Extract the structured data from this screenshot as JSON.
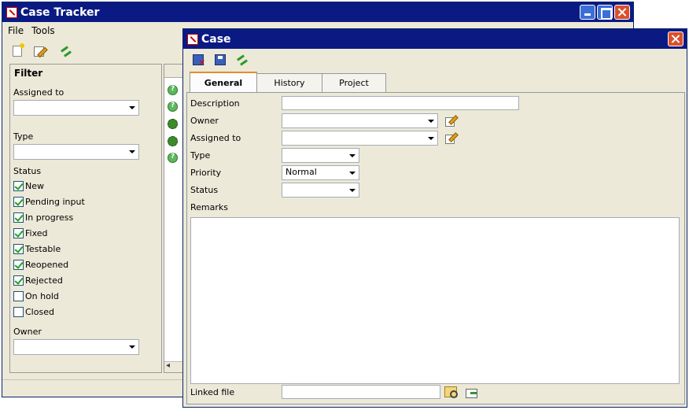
{
  "main_window": {
    "title": "Case Tracker",
    "menu": [
      "File",
      "Tools"
    ],
    "toolbar_icons": [
      "new-case-icon",
      "edit-icon",
      "refresh-icon"
    ],
    "filter": {
      "title": "Filter",
      "assigned_to_label": "Assigned to",
      "assigned_to_value": "",
      "type_label": "Type",
      "type_value": "",
      "status_label": "Status",
      "statuses": [
        {
          "label": "New",
          "checked": true
        },
        {
          "label": "Pending input",
          "checked": true
        },
        {
          "label": "In progress",
          "checked": true
        },
        {
          "label": "Fixed",
          "checked": true
        },
        {
          "label": "Testable",
          "checked": true
        },
        {
          "label": "Reopened",
          "checked": true
        },
        {
          "label": "Rejected",
          "checked": true
        },
        {
          "label": "On hold",
          "checked": false
        },
        {
          "label": "Closed",
          "checked": false
        }
      ],
      "owner_label": "Owner",
      "owner_value": ""
    },
    "list_row_icons": [
      "question-icon",
      "question-icon",
      "bug-icon",
      "bug-icon",
      "question-icon"
    ]
  },
  "case_window": {
    "title": "Case",
    "toolbar_icons": [
      "delete-icon",
      "save-icon",
      "refresh-icon"
    ],
    "tabs": [
      "General",
      "History",
      "Project"
    ],
    "active_tab": "General",
    "fields": {
      "description_label": "Description",
      "description_value": "",
      "owner_label": "Owner",
      "owner_value": "",
      "assigned_to_label": "Assigned to",
      "assigned_to_value": "",
      "type_label": "Type",
      "type_value": "",
      "priority_label": "Priority",
      "priority_value": "Normal",
      "status_label": "Status",
      "status_value": "",
      "remarks_label": "Remarks",
      "remarks_value": "",
      "linked_file_label": "Linked file",
      "linked_file_value": ""
    }
  },
  "colors": {
    "titlebar": "#0a1a82",
    "window_bg": "#ece9d8",
    "close_button": "#d9502e",
    "tab_highlight": "#e68b2c",
    "check_mark": "#21a121"
  }
}
